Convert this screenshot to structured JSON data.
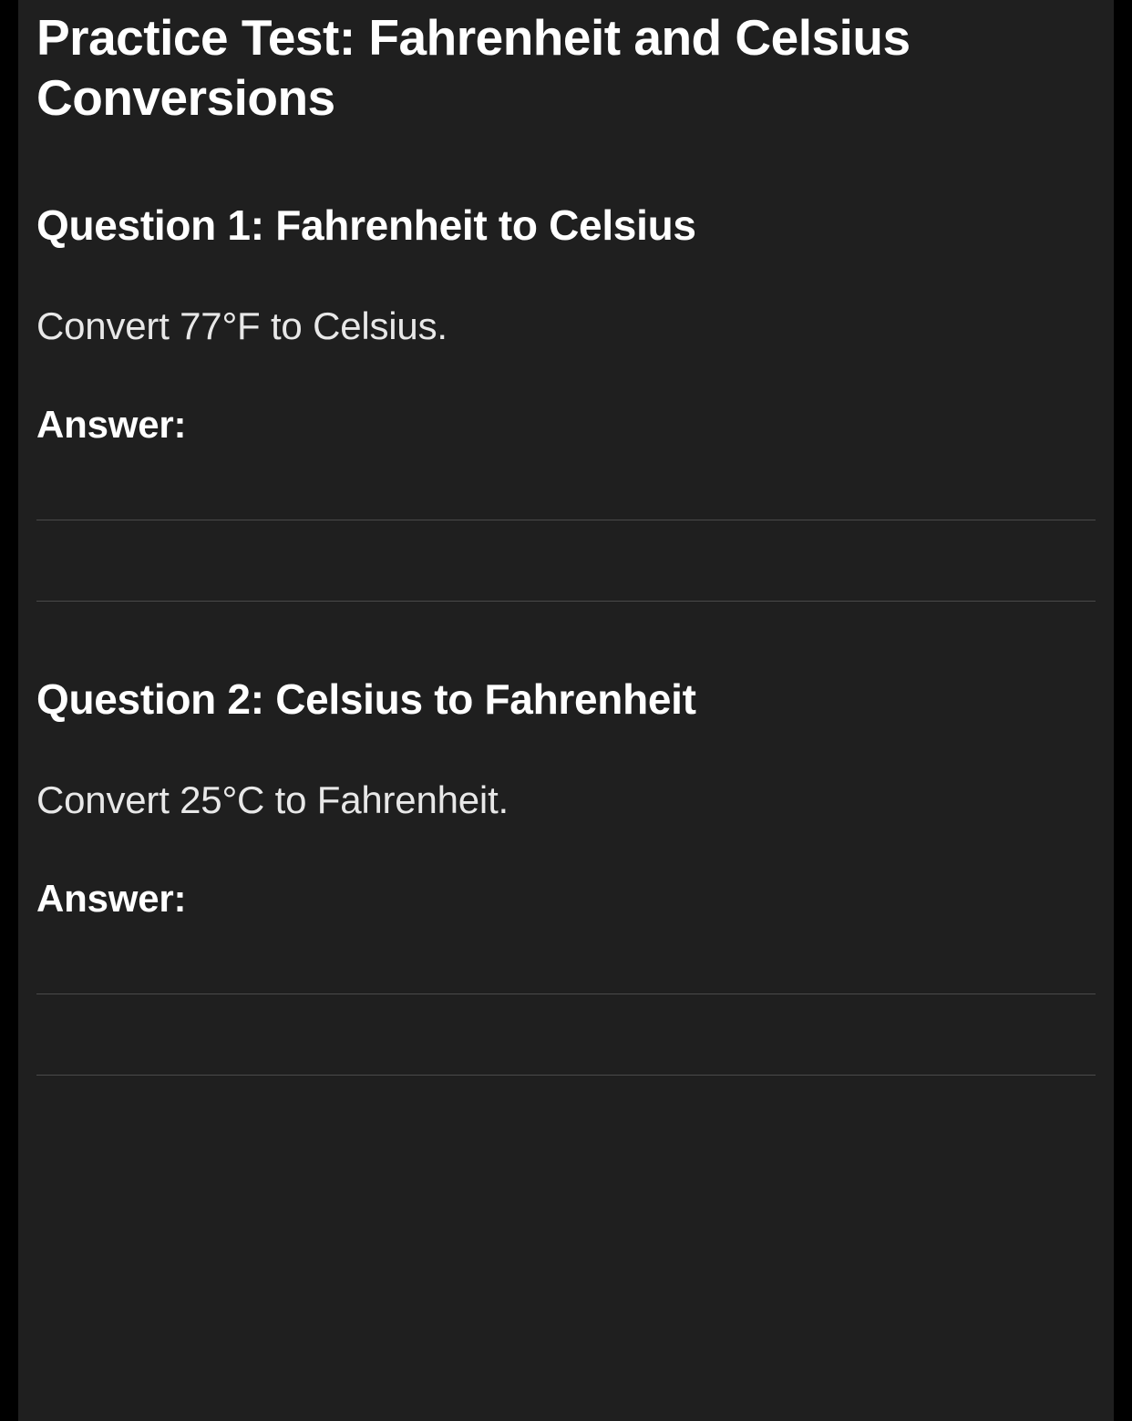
{
  "title": "Practice Test: Fahrenheit and Celsius Conversions",
  "questions": [
    {
      "heading": "Question 1: Fahrenheit to Celsius",
      "prompt": "Convert 77°F to Celsius.",
      "answer_label": "Answer:"
    },
    {
      "heading": "Question 2: Celsius to Fahrenheit",
      "prompt": "Convert 25°C to Fahrenheit.",
      "answer_label": "Answer:"
    }
  ]
}
